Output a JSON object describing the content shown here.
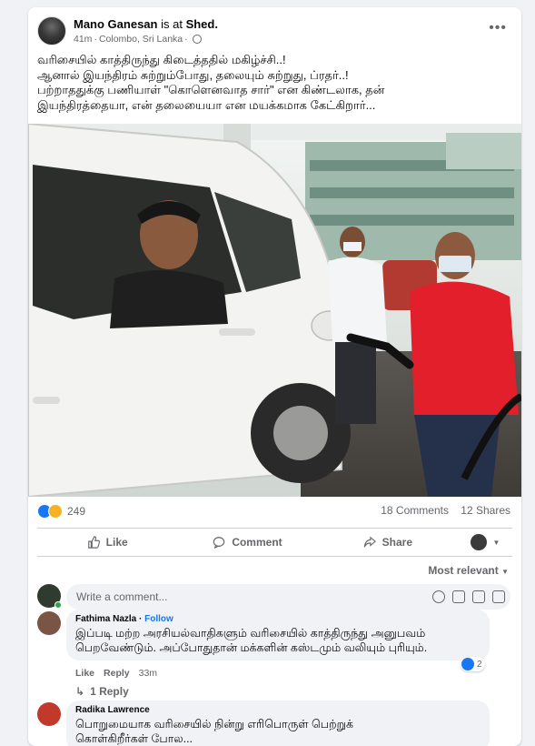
{
  "post": {
    "author": "Mano Ganesan",
    "checkin_text": "is at",
    "place": "Shed.",
    "time": "41m",
    "location": "Colombo, Sri Lanka",
    "caption_lines": [
      "வரிசையில் காத்திருந்து கிடைத்ததில் மகிழ்ச்சி..!",
      "ஆனால் இயந்திரம் சுற்றும்போது, தலையும் சுற்றுது, ப்ரதர்..!",
      "பற்றாததுக்கு பணியாள் \"கொளெனவாத சார்\" என கிண்டலாக, தன்",
      "இயந்திரத்தையா, என் தலையையா என மயக்கமாக கேட்கிறார்..."
    ]
  },
  "stats": {
    "reaction_count": "249",
    "comments": "18 Comments",
    "shares": "12 Shares"
  },
  "actions": {
    "like": "Like",
    "comment": "Comment",
    "share": "Share"
  },
  "sort": {
    "label": "Most relevant"
  },
  "write_comment": {
    "placeholder": "Write a comment..."
  },
  "comments": [
    {
      "name": "Fathima Nazla",
      "follow": "Follow",
      "text_lines": [
        "இப்படி மற்ற அரசியல்வாதிகளும் வரிசையில் காத்திருந்து அனுபவம்",
        "பெறவேண்டும். அப்போதுதான் மக்களின் கஸ்டமும் வலியும் புரியும்."
      ],
      "like_count": "2",
      "like_label": "Like",
      "reply_label": "Reply",
      "time": "33m",
      "replies": "1 Reply"
    },
    {
      "name": "Radika Lawrence",
      "text_lines": [
        "பொறுமையாக வரிசையில் நின்று எரிபொருள் பெற்றுக்",
        "கொள்கிறீர்கள் போல..."
      ]
    }
  ],
  "colors": {
    "accent": "#1877f2",
    "haha": "#f7b125",
    "online": "#31a24c"
  }
}
